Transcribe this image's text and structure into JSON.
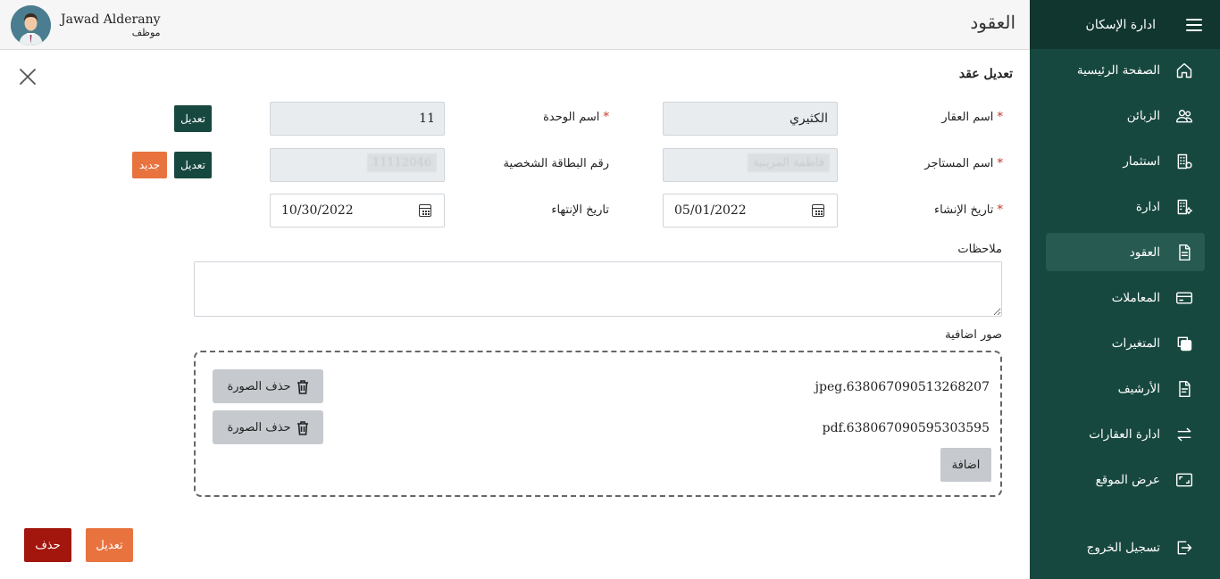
{
  "sidebar": {
    "title": "ادارة الإسكان",
    "items": [
      {
        "label": "الصفحة الرئيسية",
        "icon": "home-icon"
      },
      {
        "label": "الزبائن",
        "icon": "users-icon"
      },
      {
        "label": "استثمار",
        "icon": "building-icon"
      },
      {
        "label": "ادارة",
        "icon": "building-settings-icon"
      },
      {
        "label": "العقود",
        "icon": "document-icon"
      },
      {
        "label": "المعاملات",
        "icon": "card-icon"
      },
      {
        "label": "المتغيرات",
        "icon": "copy-icon"
      },
      {
        "label": "الأرشيف",
        "icon": "archive-icon"
      },
      {
        "label": "ادارة العقارات",
        "icon": "arrows-icon"
      },
      {
        "label": "عرض الموقع",
        "icon": "screen-icon"
      }
    ],
    "active_index": 4,
    "logout": "تسجيل الخروج"
  },
  "header": {
    "title": "العقود",
    "user_name": "Jawad Alderany",
    "user_role": "موظف"
  },
  "form": {
    "title": "تعديل عقد",
    "property_name_label": "اسم العقار",
    "property_name_value": "الكثيري",
    "unit_name_label": "اسم الوحدة",
    "unit_name_value": "11",
    "tenant_name_label": "اسم المستاجر",
    "tenant_name_value": "فاطمة المرينية",
    "id_number_label": "رقم البطاقة الشخصية",
    "id_number_value": "11112046",
    "created_date_label": "تاريخ الإنشاء",
    "created_date_value": "05/01/2022",
    "end_date_label": "تاريخ الإنتهاء",
    "end_date_value": "10/30/2022",
    "edit_btn": "تعديل",
    "new_btn": "جديد",
    "notes_label": "ملاحظات",
    "notes_value": "",
    "images_label": "صور اضافية",
    "files": [
      {
        "name": "jpeg.638067090513268207",
        "delete": "حذف الصورة"
      },
      {
        "name": "pdf.638067090595303595",
        "delete": "حذف الصورة"
      }
    ],
    "add_btn": "اضافة",
    "submit_btn": "تعديل",
    "delete_btn": "حذف"
  },
  "colors": {
    "sidebar": "#17483f",
    "accent_orange": "#e8733f",
    "danger": "#a3160e"
  }
}
